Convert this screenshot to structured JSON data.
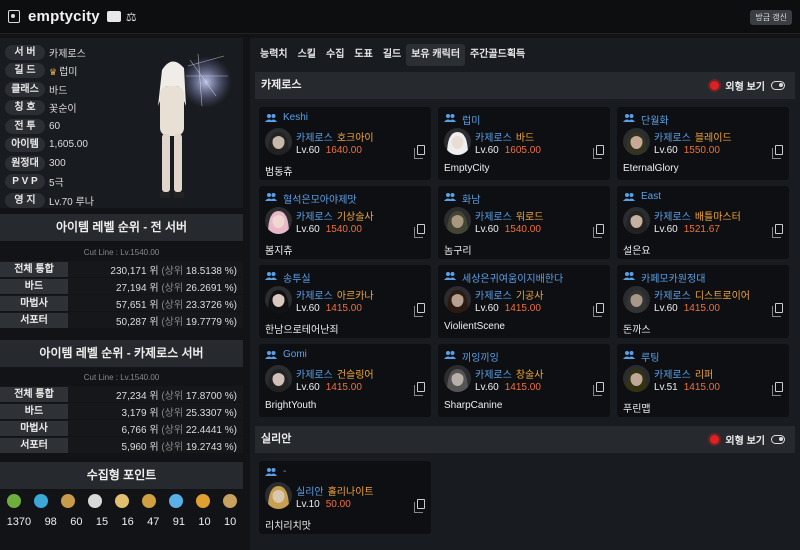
{
  "header": {
    "title": "emptycity",
    "refresh_label": "방금 갱신",
    "icons": [
      "bookmark-icon",
      "id-card-icon",
      "scale-icon"
    ]
  },
  "profile": {
    "rows": [
      {
        "label": "서 버",
        "value": "카제로스"
      },
      {
        "label": "길 드",
        "value": "럽미",
        "icon": "crown-icon"
      },
      {
        "label": "클래스",
        "value": "바드"
      },
      {
        "label": "칭 호",
        "value": "꽃순이"
      },
      {
        "label": "전 투",
        "value": "60"
      },
      {
        "label": "아이템",
        "value": "1,605.00"
      },
      {
        "label": "원정대",
        "value": "300"
      },
      {
        "label": "P V P",
        "value": "5극"
      },
      {
        "label": "영 지",
        "value": "Lv.70 루나"
      }
    ]
  },
  "rank_all": {
    "title": "아이템 레벨 순위 - 전 서버",
    "cutline": "Cut Line : Lv.1540.00",
    "rows": [
      {
        "label": "전체 통합",
        "rank": "230,171 위",
        "top_label": "(상위",
        "pct": "18.5138 %)"
      },
      {
        "label": "바드",
        "rank": "27,194 위",
        "top_label": "(상위",
        "pct": "26.2691 %)"
      },
      {
        "label": "마법사",
        "rank": "57,651 위",
        "top_label": "(상위",
        "pct": "23.3726 %)"
      },
      {
        "label": "서포터",
        "rank": "50,287 위",
        "top_label": "(상위",
        "pct": "19.7779 %)"
      }
    ]
  },
  "rank_server": {
    "title": "아이템 레벨 순위 - 카제로스 서버",
    "cutline": "Cut Line : Lv.1540.00",
    "rows": [
      {
        "label": "전체 통합",
        "rank": "27,234 위",
        "top_label": "(상위",
        "pct": "17.8700 %)"
      },
      {
        "label": "바드",
        "rank": "3,179 위",
        "top_label": "(상위",
        "pct": "25.3307 %)"
      },
      {
        "label": "마법사",
        "rank": "6,766 위",
        "top_label": "(상위",
        "pct": "22.4441 %)"
      },
      {
        "label": "서포터",
        "rank": "5,960 위",
        "top_label": "(상위",
        "pct": "19.2743 %)"
      }
    ]
  },
  "collect": {
    "title": "수집형 포인트",
    "items": [
      {
        "icon": "seed-icon",
        "color": "#6fae3c",
        "value": "1370"
      },
      {
        "icon": "island-icon",
        "color": "#3ca8d8",
        "value": "98"
      },
      {
        "icon": "painting-icon",
        "color": "#c89a4a",
        "value": "60"
      },
      {
        "icon": "heart-icon",
        "color": "#d8d8d8",
        "value": "15"
      },
      {
        "icon": "mask-icon",
        "color": "#e0c070",
        "value": "16"
      },
      {
        "icon": "sword-icon",
        "color": "#d0a040",
        "value": "47"
      },
      {
        "icon": "star-icon",
        "color": "#5ab0e8",
        "value": "91"
      },
      {
        "icon": "compass-icon",
        "color": "#e0a030",
        "value": "10"
      },
      {
        "icon": "music-icon",
        "color": "#c8a060",
        "value": "10"
      }
    ]
  },
  "tabs": [
    "능력치",
    "스킬",
    "수집",
    "도표",
    "길드",
    "보유 캐릭터",
    "주간골드획득"
  ],
  "active_tab": 5,
  "servers": [
    {
      "name": "카제로스",
      "toggle_label": "외형 보기",
      "cards": [
        {
          "guild": "Keshi",
          "server": "카제로스",
          "cls": "호크아이",
          "lv": "Lv.60",
          "ilvl": "1640.00",
          "name": "범동츄",
          "skin": "#c8b8a8",
          "hair": "#222"
        },
        {
          "guild": "럽미",
          "server": "카제로스",
          "cls": "바드",
          "lv": "Lv.60",
          "ilvl": "1605.00",
          "name": "EmptyCity",
          "skin": "#e8ddd5",
          "hair": "#eee"
        },
        {
          "guild": "단월화",
          "server": "카제로스",
          "cls": "블레이드",
          "lv": "Lv.60",
          "ilvl": "1550.00",
          "name": "EternalGlory",
          "skin": "#c8a898",
          "hair": "#332"
        },
        {
          "guild": "혈석은모아야제맛",
          "server": "카제로스",
          "cls": "기상술사",
          "lv": "Lv.60",
          "ilvl": "1540.00",
          "name": "봄지츄",
          "skin": "#f0d8d0",
          "hair": "#e8b8c8"
        },
        {
          "guild": "화남",
          "server": "카제로스",
          "cls": "워로드",
          "lv": "Lv.60",
          "ilvl": "1540.00",
          "name": "놈구리",
          "skin": "#a89880",
          "hair": "#443"
        },
        {
          "guild": "East",
          "server": "카제로스",
          "cls": "배틀마스터",
          "lv": "Lv.60",
          "ilvl": "1521.67",
          "name": "설은요",
          "skin": "#c8b0a0",
          "hair": "#222"
        },
        {
          "guild": "송투실",
          "server": "카제로스",
          "cls": "아르카나",
          "lv": "Lv.60",
          "ilvl": "1415.00",
          "name": "한남으로테어난죄",
          "skin": "#d8c8c0",
          "hair": "#111"
        },
        {
          "guild": "세상은귀여움이지배한다",
          "server": "카제로스",
          "cls": "기공사",
          "lv": "Lv.60",
          "ilvl": "1415.00",
          "name": "ViolientScene",
          "skin": "#b8a090",
          "hair": "#2a1a10"
        },
        {
          "guild": "카페모카원정대",
          "server": "카제로스",
          "cls": "디스트로이어",
          "lv": "Lv.60",
          "ilvl": "1415.00",
          "name": "돈까스",
          "skin": "#a89888",
          "hair": "#333"
        },
        {
          "guild": "Gomi",
          "server": "카제로스",
          "cls": "건슬링어",
          "lv": "Lv.60",
          "ilvl": "1415.00",
          "name": "BrightYouth",
          "skin": "#d0c0b8",
          "hair": "#222"
        },
        {
          "guild": "끼잉끼잉",
          "server": "카제로스",
          "cls": "창술사",
          "lv": "Lv.60",
          "ilvl": "1415.00",
          "name": "SharpCanine",
          "skin": "#b8b0a8",
          "hair": "#555"
        },
        {
          "guild": "루팅",
          "server": "카제로스",
          "cls": "리퍼",
          "lv": "Lv.51",
          "ilvl": "1415.00",
          "name": "푸린맵",
          "skin": "#c0a898",
          "hair": "#331"
        }
      ]
    },
    {
      "name": "실리안",
      "toggle_label": "외형 보기",
      "cards": [
        {
          "guild": "-",
          "server": "실리안",
          "cls": "홀리나이트",
          "lv": "Lv.10",
          "ilvl": "50.00",
          "name": "리치리치맛",
          "skin": "#d8c8b0",
          "hair": "#c8a050"
        }
      ]
    }
  ]
}
